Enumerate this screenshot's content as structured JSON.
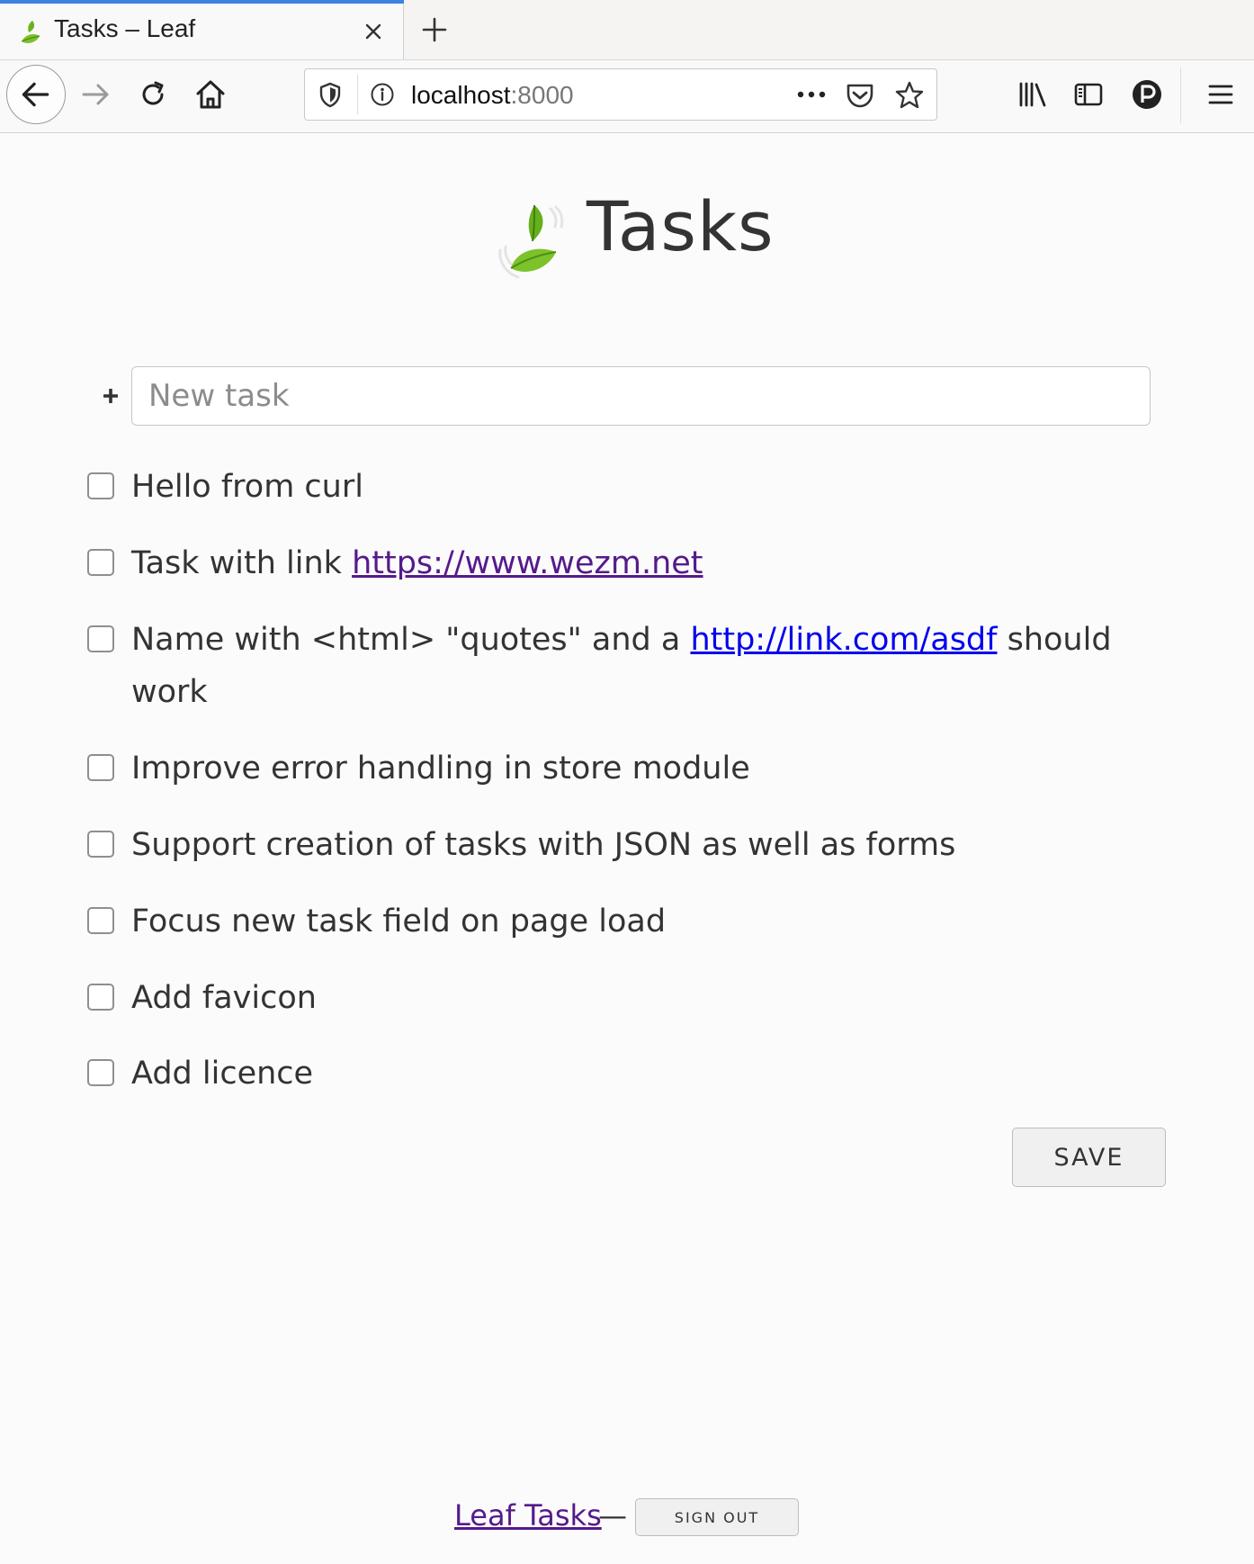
{
  "browser": {
    "tab": {
      "title": "Tasks – Leaf"
    },
    "url": {
      "host": "localhost",
      "port": ":8000"
    }
  },
  "page": {
    "title": "Tasks",
    "new_task_placeholder": "New task",
    "tasks": [
      {
        "text": "Hello from curl",
        "checked": false
      },
      {
        "prefix": "Task with link ",
        "link": "https://www.wezm.net",
        "link_state": "visited",
        "checked": false
      },
      {
        "prefix": "Name with <html> \"quotes\" and a ",
        "link": "http://link.com/asdf",
        "suffix": " should work",
        "link_state": "unvisited",
        "checked": false
      },
      {
        "text": "Improve error handling in store module",
        "checked": false
      },
      {
        "text": "Support creation of tasks with JSON as well as forms",
        "checked": false
      },
      {
        "text": "Focus new task field on page load",
        "checked": false
      },
      {
        "text": "Add favicon",
        "checked": false
      },
      {
        "text": "Add licence",
        "checked": false
      }
    ],
    "save_label": "SAVE"
  },
  "footer": {
    "link_text": "Leaf Tasks",
    "separator": "—",
    "signout_label": "SIGN OUT"
  },
  "colors": {
    "tab_accent": "#3c82e0",
    "leaf_green": "#7cc22a",
    "visited_link": "#551a8b",
    "unvisited_link": "#0000ee"
  },
  "icons": [
    "leaf-logo-icon",
    "close-icon",
    "plus-icon",
    "back-arrow-icon",
    "forward-arrow-icon",
    "reload-icon",
    "home-icon",
    "shield-icon",
    "info-icon",
    "more-icon",
    "pocket-icon",
    "star-icon",
    "library-icon",
    "sidebar-icon",
    "account-icon",
    "menu-icon",
    "add-icon"
  ]
}
